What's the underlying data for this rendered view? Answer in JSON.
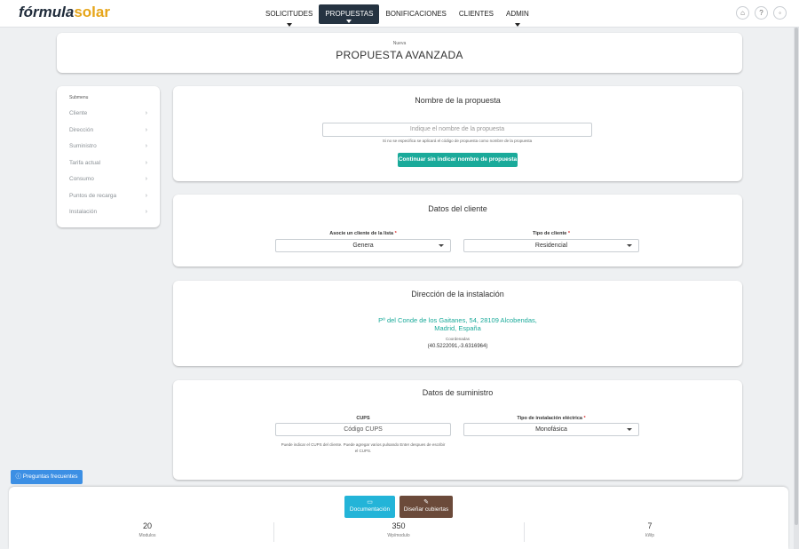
{
  "brand": {
    "part1": "fórmula",
    "part2": "solar"
  },
  "nav": {
    "items": [
      {
        "label": "SOLICITUDES",
        "active": false,
        "dropdown": true
      },
      {
        "label": "PROPUESTAS",
        "active": true,
        "dropdown": true
      },
      {
        "label": "BONIFICACIONES",
        "active": false,
        "dropdown": false
      },
      {
        "label": "CLIENTES",
        "active": false,
        "dropdown": false
      },
      {
        "label": "ADMIN",
        "active": false,
        "dropdown": true
      }
    ],
    "icons": [
      "home-icon",
      "help-icon",
      "power-icon"
    ]
  },
  "header": {
    "sup": "Nueva",
    "title": "PROPUESTA AVANZADA"
  },
  "submenu": {
    "title": "Submenu",
    "items": [
      "Cliente",
      "Dirección",
      "Suministro",
      "Tarifa actual",
      "Consumo",
      "Puntos de recarga",
      "Instalación"
    ]
  },
  "sec_name": {
    "title": "Nombre de la propuesta",
    "placeholder": "Indique el nombre de la propuesta",
    "help": "Si no se especifica se aplicará el código de propuesta como nombre de la propuesta",
    "button": "Continuar sin indicar nombre de propuesta"
  },
  "sec_client": {
    "title": "Datos del cliente",
    "associate_label": "Asocie un cliente de la lista",
    "associate_value": "Genera",
    "type_label": "Tipo de cliente",
    "type_value": "Residencial"
  },
  "sec_address": {
    "title": "Dirección de la instalación",
    "address_line1": "Pº del Conde de los Gaitanes, 54, 28109 Alcobendas,",
    "address_line2": "Madrid, España",
    "coords_label": "Coordenadas",
    "coords_value": "(40.5222091,-3.6316964)"
  },
  "sec_supply": {
    "title": "Datos de suministro",
    "cups_label": "CUPS",
    "cups_placeholder": "Código CUPS",
    "cups_help_1": "Puede indicar el CUPS del cliente. Puede agregar varios pulsando Enter despues de escribir",
    "cups_help_2": "el CUPS.",
    "install_label": "Tipo de instalación eléctrica",
    "install_value": "Monofásica"
  },
  "faq_button": "Preguntas frecuentes",
  "bottom": {
    "doc_button": "Documentación",
    "design_button": "Diseñar cubiertas",
    "stats": [
      {
        "value": "20",
        "unit": "Modulos"
      },
      {
        "value": "350",
        "unit": "Wp/modulo"
      },
      {
        "value": "7",
        "unit": "kWp"
      }
    ]
  },
  "colors": {
    "accent": "#1aaa9a",
    "nav_active": "#253341",
    "faq": "#3c8fe4",
    "doc": "#23b4d8",
    "design": "#6b4a3a",
    "required": "#d33333"
  }
}
